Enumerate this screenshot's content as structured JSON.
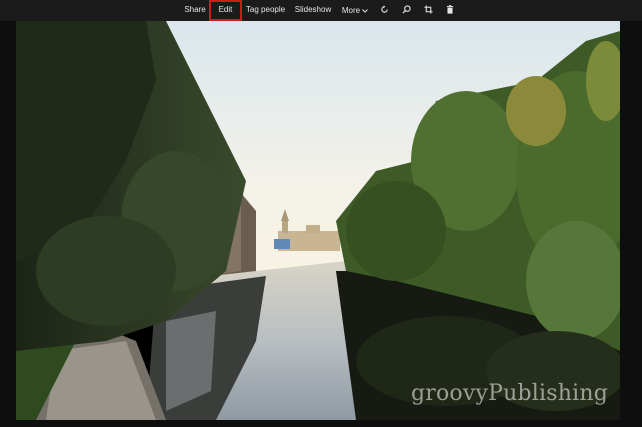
{
  "toolbar": {
    "share_label": "Share",
    "edit_label": "Edit",
    "tag_people_label": "Tag people",
    "slideshow_label": "Slideshow",
    "more_label": "More",
    "icons": [
      "rotate-icon",
      "zoom-icon",
      "crop-icon",
      "trash-icon"
    ],
    "highlight_color": "#d11a1a"
  },
  "photo": {
    "watermark": "groovyPublishing"
  }
}
